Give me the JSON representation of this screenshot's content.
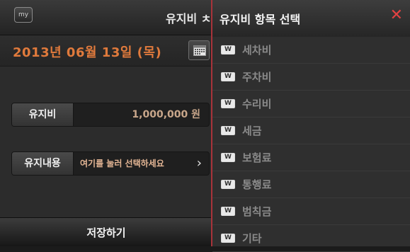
{
  "background_screen": {
    "my_button": "my",
    "title_partial": "유지비 ㅊ",
    "date": "2013년 06월 13일 (목)",
    "calendar_icon": "calendar-icon",
    "cost_label": "유지비",
    "cost_value": "1,000,000 원",
    "detail_label": "유지내용",
    "detail_placeholder": "여기를 눌러 선택하세요",
    "detail_chevron": "›",
    "save_label": "저장하기"
  },
  "panel": {
    "title": "유지비 항목 선택",
    "close_glyph": "✕",
    "item_icon": "won-tag-icon",
    "item_icon_text": "W",
    "items": [
      {
        "label": "세차비"
      },
      {
        "label": "주차비"
      },
      {
        "label": "수리비"
      },
      {
        "label": "세금"
      },
      {
        "label": "보험료"
      },
      {
        "label": "통행료"
      },
      {
        "label": "범칙금"
      },
      {
        "label": "기타"
      }
    ]
  },
  "colors": {
    "date_accent": "#e07a3c",
    "close_red": "#e34242",
    "panel_border": "#a8333a"
  }
}
